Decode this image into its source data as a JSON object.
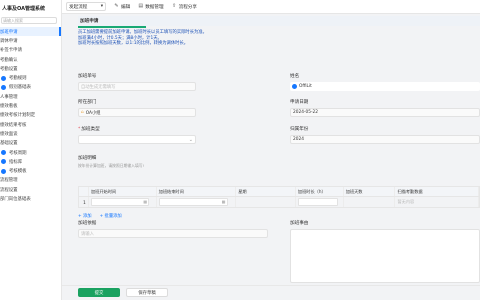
{
  "sidebar": {
    "brand": "人事及OA管理系统",
    "search_placeholder": "请输入搜索",
    "items": [
      {
        "label": "加班申请",
        "sub": false,
        "active": true,
        "dot": false
      },
      {
        "label": "调休申请",
        "sub": false,
        "active": false,
        "dot": false
      },
      {
        "label": "补签卡申请",
        "sub": false,
        "active": false,
        "dot": false
      },
      {
        "label": "考勤确认",
        "sub": false,
        "active": false,
        "dot": false
      },
      {
        "label": "考勤设置",
        "sub": false,
        "active": false,
        "dot": false
      },
      {
        "label": "考勤规则",
        "sub": true,
        "active": false,
        "dot": true
      },
      {
        "label": "假别基础表",
        "sub": true,
        "active": false,
        "dot": true
      },
      {
        "label": "人事管理",
        "sub": false,
        "active": false,
        "dot": false
      },
      {
        "label": "绩效看板",
        "sub": false,
        "active": false,
        "dot": false
      },
      {
        "label": "绩效考核计划制定",
        "sub": false,
        "active": false,
        "dot": false
      },
      {
        "label": "绩效结果考核",
        "sub": false,
        "active": false,
        "dot": false
      },
      {
        "label": "绩效面谈",
        "sub": false,
        "active": false,
        "dot": false
      },
      {
        "label": "基础设置",
        "sub": false,
        "active": false,
        "dot": false
      },
      {
        "label": "考核周期",
        "sub": true,
        "active": false,
        "dot": true
      },
      {
        "label": "指标库",
        "sub": true,
        "active": false,
        "dot": true
      },
      {
        "label": "考核模板",
        "sub": true,
        "active": false,
        "dot": true
      },
      {
        "label": "流程管理",
        "sub": false,
        "active": false,
        "dot": false
      },
      {
        "label": "流程设置",
        "sub": false,
        "active": false,
        "dot": false
      },
      {
        "label": "部门岗位基础表",
        "sub": false,
        "active": false,
        "dot": false
      }
    ]
  },
  "topbar": {
    "select_value": "发起流程",
    "actions": [
      {
        "label": "编辑",
        "icon": "edit-icon",
        "glyph": "✎"
      },
      {
        "label": "数据管理",
        "icon": "database-icon",
        "glyph": "▤"
      },
      {
        "label": "流程分享",
        "icon": "share-icon",
        "glyph": "⇪"
      }
    ]
  },
  "form": {
    "section_title": "加班申请",
    "description": [
      "员工加班需要提前加班申请。加班时长以员工填写的实际时长为准。",
      "加班满4小时，计0.5天；满8小时，计1天。",
      "加班时长按照加班天数，以1:1的比例，转换为调休时长。"
    ],
    "fields": {
      "apply_no": {
        "label": "加班单号",
        "placeholder": "自动生成无需填写"
      },
      "name": {
        "label": "姓名",
        "value": "OffiLit"
      },
      "dept": {
        "label": "所在部门",
        "value": "OA小组"
      },
      "apply_date": {
        "label": "申请日期",
        "value": "2024-05-22"
      },
      "ot_type": {
        "label": "加班类型",
        "placeholder": ""
      },
      "month": {
        "label": "归属年份",
        "value": "2024"
      },
      "details": {
        "label": "加班明细",
        "hint": "按年份计算加班，请按照日期输入填写!"
      },
      "attachments": {
        "label": "加班依据",
        "placeholder": "请输入"
      },
      "remark": {
        "label": "加班事由"
      }
    },
    "table": {
      "headers": [
        "",
        "加班开始时间",
        "加班结束时间",
        "星期",
        "加班时长（h）",
        "加班天数",
        "扫描考勤数据"
      ],
      "rows": [
        {
          "index": "1",
          "start": "",
          "end": "",
          "weekday": "",
          "hours": "",
          "days": "",
          "scan": "暂无内容"
        }
      ],
      "add_label": "+ 添加",
      "batch_label": "+ 批量添加"
    },
    "buttons": {
      "submit": "提交",
      "save_draft": "保存草稿"
    }
  }
}
